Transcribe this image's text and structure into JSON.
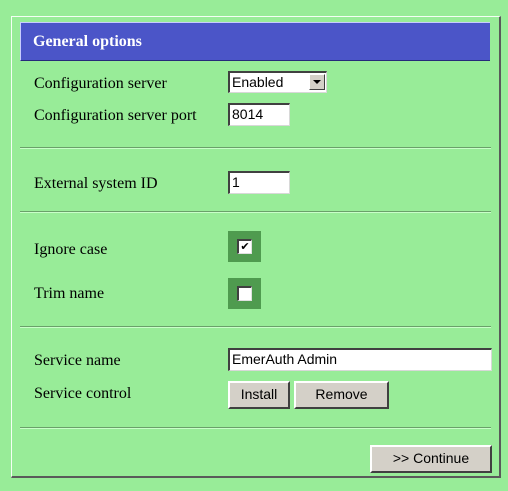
{
  "panel": {
    "title": "General options"
  },
  "config_server": {
    "label": "Configuration server",
    "selected": "Enabled"
  },
  "config_port": {
    "label": "Configuration server port",
    "value": "8014"
  },
  "external_id": {
    "label": "External system ID",
    "value": "1"
  },
  "ignore_case": {
    "label": "Ignore case",
    "checked": true,
    "mark": "✔"
  },
  "trim_name": {
    "label": "Trim name",
    "checked": false,
    "mark": ""
  },
  "service_name": {
    "label": "Service name",
    "value": "EmerAuth Admin"
  },
  "service_control": {
    "label": "Service control",
    "install_label": "Install",
    "remove_label": "Remove"
  },
  "footer": {
    "continue_label": ">> Continue"
  },
  "colors": {
    "background": "#98ec98",
    "title_bar": "#4b55c8",
    "checkbox_well": "#4f9b4f",
    "button_face": "#d4d0c8"
  }
}
